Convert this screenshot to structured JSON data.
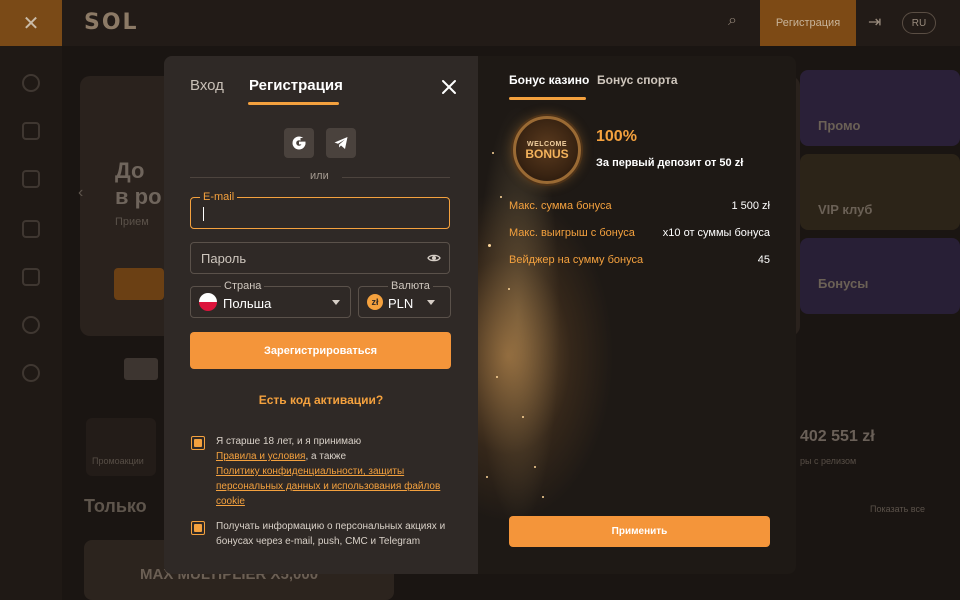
{
  "background": {
    "logo": "SOL",
    "header_register": "Регистрация",
    "lang": "RU",
    "banner_title_line1": "До",
    "banner_title_line2": "в ро",
    "banner_sub": "Прием",
    "card_promo": "Промо",
    "card_vip": "VIP клуб",
    "card_bonuses": "Бонусы",
    "stat_value": "402 551 zł",
    "stat_sub": "ры с релизом",
    "only_title": "Только",
    "show_all": "Показать все",
    "promo_label": "Промоакции",
    "game_title": "MAX MULTIPLIER X5,000"
  },
  "form": {
    "tab_login": "Вход",
    "tab_register": "Регистрация",
    "or": "или",
    "email_label": "E-mail",
    "email_value": "",
    "password_placeholder": "Пароль",
    "country_label": "Страна",
    "country_value": "Польша",
    "currency_label": "Валюта",
    "currency_value": "PLN",
    "currency_icon_text": "zł",
    "register_button": "Зарегистрироваться",
    "activation_link": "Есть код активации?",
    "consent1_text": "Я старше 18 лет, и я принимаю",
    "consent1_link1": "Правила и условия",
    "consent1_mid": ", а также",
    "consent1_link2": "Политику конфиденциальности, защиты персональных данных и использования файлов cookie",
    "consent2_text": "Получать информацию о персональных акциях и бонусах через e-mail, push, СМС и Telegram"
  },
  "bonus": {
    "tab_casino": "Бонус казино",
    "tab_sport": "Бонус спорта",
    "badge_top": "WELCOME",
    "badge_bottom": "BONUS",
    "percent": "100%",
    "description": "За первый депозит от 50 zł",
    "rows": [
      {
        "label": "Макс. сумма бонуса",
        "value": "1 500 zł"
      },
      {
        "label": "Макс. выигрыш с бонуса",
        "value": "x10 от суммы бонуса"
      },
      {
        "label": "Вейджер на сумму бонуса",
        "value": "45"
      }
    ],
    "apply_button": "Применить"
  },
  "colors": {
    "accent": "#f4a13e",
    "button": "#f4953a",
    "modal_bg": "#2f2926"
  }
}
